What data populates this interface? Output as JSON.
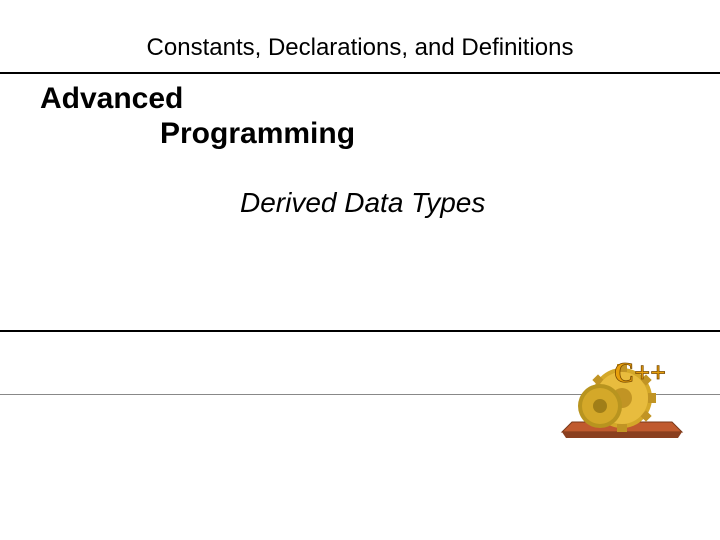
{
  "header": {
    "title": "Constants, Declarations, and Definitions"
  },
  "main": {
    "line1": "Advanced",
    "line2": "Programming",
    "subtitle": "Derived Data Types"
  },
  "logo": {
    "text": "C++"
  }
}
